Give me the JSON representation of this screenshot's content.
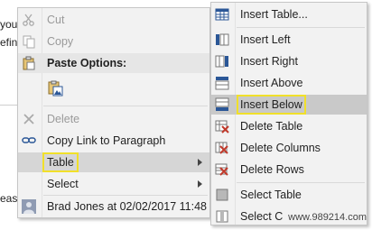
{
  "document": {
    "lines": [
      "you",
      "efin",
      "eas"
    ]
  },
  "context_menu": {
    "items": [
      {
        "label": "Cut",
        "icon": "scissors-icon",
        "disabled": true
      },
      {
        "label": "Copy",
        "icon": "copy-icon",
        "disabled": true
      },
      {
        "label": "Paste Options:",
        "icon": "clipboard-icon",
        "disabled": false
      },
      {
        "label": "",
        "icon": "paste-picture-icon",
        "disabled": false
      },
      {
        "label": "Delete",
        "icon": "delete-x-icon",
        "disabled": true
      },
      {
        "label": "Copy Link to Paragraph",
        "icon": "link-icon",
        "disabled": false
      },
      {
        "label": "Table",
        "icon": "",
        "disabled": false
      },
      {
        "label": "Select",
        "icon": "",
        "disabled": false
      },
      {
        "label": "Brad Jones at 02/02/2017 11:48",
        "icon": "user-icon",
        "disabled": false
      }
    ]
  },
  "table_submenu": {
    "items": [
      {
        "label": "Insert Table...",
        "icon": "insert-table-icon"
      },
      {
        "label": "Insert Left",
        "icon": "insert-left-icon"
      },
      {
        "label": "Insert Right",
        "icon": "insert-right-icon"
      },
      {
        "label": "Insert Above",
        "icon": "insert-above-icon"
      },
      {
        "label": "Insert Below",
        "icon": "insert-below-icon"
      },
      {
        "label": "Delete Table",
        "icon": "delete-table-icon"
      },
      {
        "label": "Delete Columns",
        "icon": "delete-columns-icon"
      },
      {
        "label": "Delete Rows",
        "icon": "delete-rows-icon"
      },
      {
        "label": "Select Table",
        "icon": "select-table-icon"
      },
      {
        "label": "Select C",
        "icon": "select-column-icon"
      }
    ]
  },
  "watermark": "www.989214.com",
  "colors": {
    "menu_bg": "#f2f2f2",
    "hover": "#d6d6d6",
    "highlight_outline": "#f1e02a",
    "icon_blue": "#2b5797",
    "icon_red": "#c0392b"
  }
}
